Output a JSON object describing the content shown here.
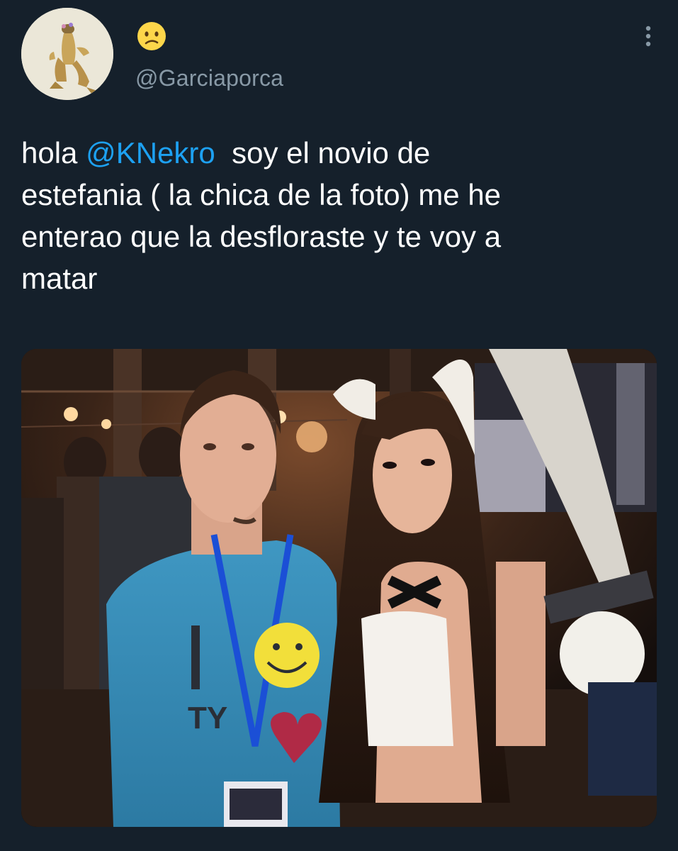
{
  "tweet": {
    "display_name_emoji": "confused-face-emoji",
    "handle": "@Garciaporca",
    "text_before": "hola ",
    "mention": "@KNekro",
    "text_after": "  soy el novio de\nestefania ( la chica de la foto) me he\nenterao que la desfloraste y te voy a\nmatar",
    "more_icon": "more-vertical-icon"
  },
  "colors": {
    "background": "#15202b",
    "text": "#ffffff",
    "secondary_text": "#8899a6",
    "link": "#1da1f2"
  }
}
